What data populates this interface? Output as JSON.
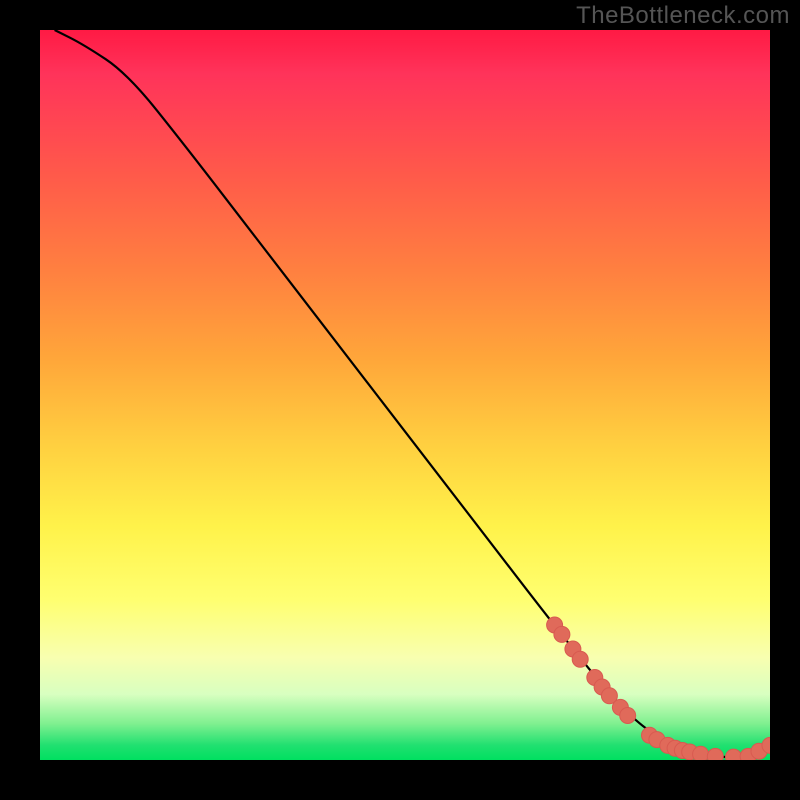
{
  "watermark": "TheBottleneck.com",
  "chart_data": {
    "type": "line",
    "title": "",
    "xlabel": "",
    "ylabel": "",
    "xlim": [
      0,
      100
    ],
    "ylim": [
      0,
      100
    ],
    "series": [
      {
        "name": "curve",
        "x": [
          2,
          6,
          12,
          20,
          30,
          40,
          50,
          60,
          70,
          78,
          82,
          85,
          88,
          90,
          92,
          94,
          96,
          98,
          100
        ],
        "y": [
          100,
          98,
          94,
          84,
          71,
          58,
          45,
          32,
          19,
          9,
          5,
          3,
          1.5,
          0.8,
          0.5,
          0.4,
          0.4,
          1.0,
          2.0
        ]
      }
    ],
    "markers": {
      "name": "highlighted-points",
      "color": "#e06a5a",
      "x": [
        70.5,
        71.5,
        73,
        74,
        76,
        77,
        78,
        79.5,
        80.5,
        83.5,
        84.5,
        86,
        87,
        88,
        89,
        90.5,
        92.5,
        95,
        97,
        98.5,
        100
      ],
      "y": [
        18.5,
        17.2,
        15.2,
        13.8,
        11.3,
        10.0,
        8.8,
        7.2,
        6.1,
        3.4,
        2.8,
        2.0,
        1.6,
        1.3,
        1.1,
        0.8,
        0.5,
        0.4,
        0.5,
        1.2,
        2.0
      ]
    },
    "background": {
      "type": "vertical-gradient",
      "stops": [
        {
          "pos": 0.0,
          "color": "#ff1a44"
        },
        {
          "pos": 0.33,
          "color": "#ff8040"
        },
        {
          "pos": 0.68,
          "color": "#fff24a"
        },
        {
          "pos": 0.91,
          "color": "#d8ffc0"
        },
        {
          "pos": 1.0,
          "color": "#00e060"
        }
      ]
    }
  }
}
